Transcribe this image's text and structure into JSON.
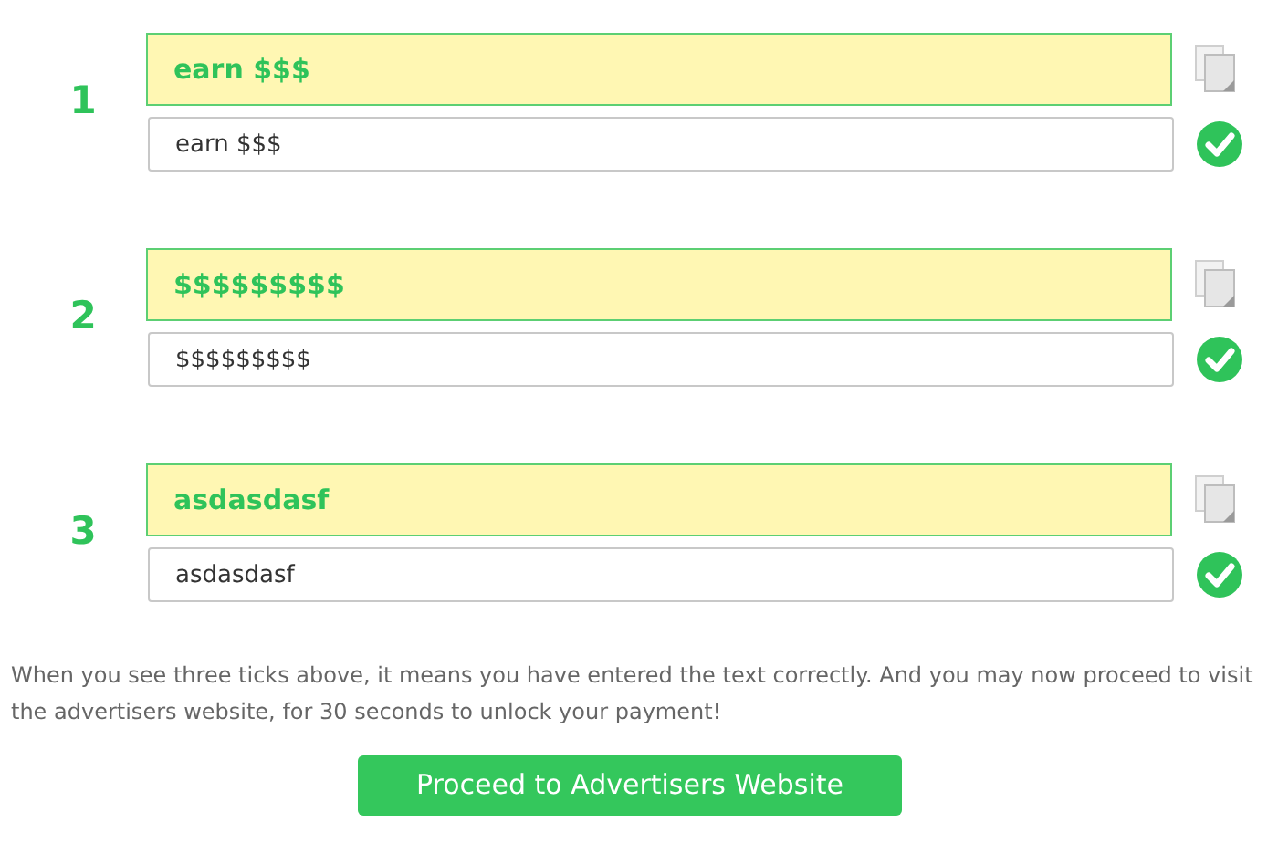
{
  "captchas": [
    {
      "number": "1",
      "prompt": "earn $$$",
      "value": "earn $$$",
      "correct": true
    },
    {
      "number": "2",
      "prompt": "$$$$$$$$$",
      "value": "$$$$$$$$$",
      "correct": true
    },
    {
      "number": "3",
      "prompt": "asdasdasf",
      "value": "asdasdasf",
      "correct": true
    }
  ],
  "instructions": "When you see three ticks above, it means you have entered the text correctly. And you may now proceed to visit the advertisers website, for 30 seconds to unlock your payment!",
  "button": "Proceed to Advertisers Website"
}
